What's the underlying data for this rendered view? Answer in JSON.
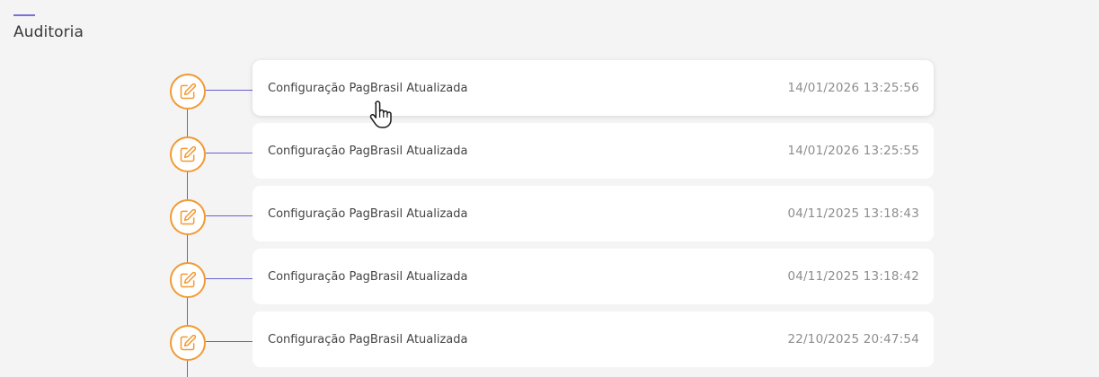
{
  "section": {
    "title": "Auditoria"
  },
  "colors": {
    "accent": "#7a6fd6",
    "node_border": "#f29a33",
    "timeline_line": "#6a60cf",
    "card_bg": "#ffffff",
    "page_bg": "#f4f4f4"
  },
  "timeline": {
    "events": [
      {
        "title": "Configuração PagBrasil Atualizada",
        "time": "14/01/2026 13:25:56",
        "icon": "edit-icon"
      },
      {
        "title": "Configuração PagBrasil Atualizada",
        "time": "14/01/2026 13:25:55",
        "icon": "edit-icon"
      },
      {
        "title": "Configuração PagBrasil Atualizada",
        "time": "04/11/2025 13:18:43",
        "icon": "edit-icon"
      },
      {
        "title": "Configuração PagBrasil Atualizada",
        "time": "04/11/2025 13:18:42",
        "icon": "edit-icon"
      },
      {
        "title": "Configuração PagBrasil Atualizada",
        "time": "22/10/2025 20:47:54",
        "icon": "edit-icon"
      }
    ]
  }
}
